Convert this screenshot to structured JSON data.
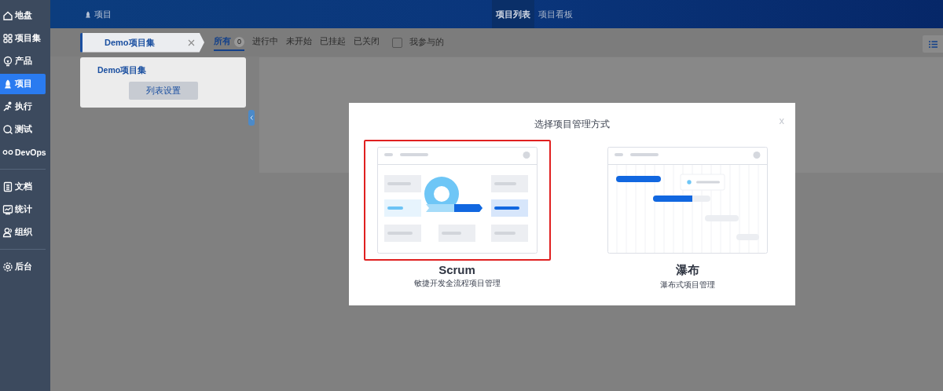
{
  "sidebar": {
    "groups": [
      [
        {
          "label": "地盘",
          "selected": false
        },
        {
          "label": "项目集",
          "selected": false
        },
        {
          "label": "产品",
          "selected": false
        },
        {
          "label": "项目",
          "selected": true
        },
        {
          "label": "执行",
          "selected": false
        },
        {
          "label": "测试",
          "selected": false
        },
        {
          "label": "DevOps",
          "selected": false
        }
      ],
      [
        {
          "label": "文档",
          "selected": false
        },
        {
          "label": "统计",
          "selected": false
        },
        {
          "label": "组织",
          "selected": false
        }
      ],
      [
        {
          "label": "后台",
          "selected": false
        }
      ]
    ]
  },
  "header": {
    "breadcrumb": "项目",
    "nav": [
      {
        "label": "项目列表",
        "selected": true
      },
      {
        "label": "项目看板",
        "selected": false
      }
    ]
  },
  "toolbar": {
    "program_tab": "Demo项目集",
    "filters": [
      {
        "label": "所有",
        "count": "0",
        "selected": true
      },
      {
        "label": "进行中",
        "selected": false
      },
      {
        "label": "未开始",
        "selected": false
      },
      {
        "label": "已挂起",
        "selected": false
      },
      {
        "label": "已关闭",
        "selected": false
      }
    ],
    "checkbox": {
      "label": "我参与的",
      "checked": false
    }
  },
  "left_panel": {
    "title": "Demo项目集",
    "button": "列表设置"
  },
  "dialog": {
    "title": "选择项目管理方式",
    "close": "x",
    "options": [
      {
        "kind": "scrum",
        "name": "Scrum",
        "description": "敏捷开发全流程项目管理",
        "selected": true
      },
      {
        "kind": "waterfall",
        "name": "瀑布",
        "description": "瀑布式项目管理",
        "selected": false
      }
    ]
  }
}
